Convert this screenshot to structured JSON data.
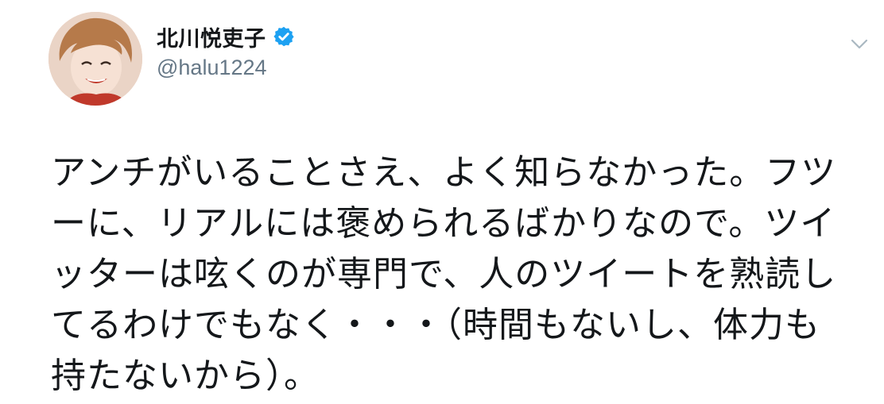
{
  "tweet": {
    "author": {
      "display_name": "北川悦吏子",
      "handle": "@halu1224",
      "verified": true
    },
    "text": "アンチがいることさえ、よく知らなかった。フツーに、リアルには褒められるばかりなので。ツイッターは呟くのが専門で、人のツイートを熟読してるわけでもなく・・・（時間もないし、体力も持たないから）。"
  },
  "colors": {
    "verified_badge": "#1da1f2",
    "handle_gray": "#657786",
    "text": "#14171a",
    "caret_gray": "#aab8c2"
  },
  "icons": {
    "avatar": "profile-photo",
    "verified": "verified-badge-icon",
    "caret": "chevron-down-icon"
  }
}
